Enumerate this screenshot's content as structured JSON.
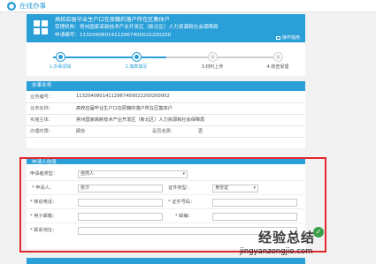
{
  "topbar": {
    "title": "在线办事"
  },
  "header": {
    "line1": "高校应届毕业生户口在原籍的落户所在区集体户",
    "line2": "受理机构：常州国家高新技术产业开发区（新北区）人力资源和社会保障局",
    "line3": "申请编号：11320408014112967400022200200",
    "print_label": "操作指南"
  },
  "steps": [
    {
      "label": "1.办事须知",
      "active": true
    },
    {
      "label": "2.填表填写",
      "active": true
    },
    {
      "label": "3.材料上传",
      "active": false
    },
    {
      "label": "4.核查受理",
      "active": false
    }
  ],
  "info": {
    "section_title": "办事业务",
    "rows": [
      {
        "k": "业务编号：",
        "v": "11320408014112967400022200200002"
      },
      {
        "k": "业务名称：",
        "v": "高校应届毕业生户口在原籍的落户所在区集体户"
      },
      {
        "k": "实施主体：",
        "v": "常州国家高新技术产业开发区（新北区）人力资源和社会保障局"
      },
      {
        "k": "办理时限：",
        "v": "即办",
        "k2": "是否收费：",
        "v2": "否"
      }
    ]
  },
  "applicant": {
    "section_title": "申请人信息",
    "type_label": "申请者类型：",
    "type_value": "自然人",
    "name_label": "* 申请人：",
    "name_value": "张汐",
    "idtype_label": "证件类型：",
    "idtype_value": "身份证",
    "phone_label": "* 移动电话：",
    "idno_label": "* 证件号码：",
    "email_label": "* 电子邮箱：",
    "postcode_label": "* 邮编：",
    "address_label": "* 联系地址："
  },
  "watermark": {
    "cn": "经验总结",
    "url": "jingyanzongjie.com"
  },
  "colors": {
    "accent": "#2a9fd8",
    "highlight": "#e0282e",
    "watermark_check": "#3aa048"
  },
  "icons": {
    "title": "info-circle-icon",
    "logo": "grid-logo-icon",
    "print": "printer-icon"
  }
}
